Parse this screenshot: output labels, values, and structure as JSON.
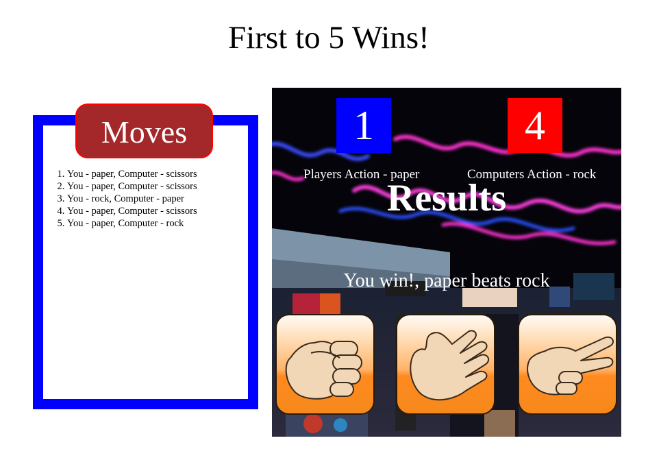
{
  "title": "First to 5 Wins!",
  "moves": {
    "heading": "Moves",
    "items": [
      "You - paper, Computer - scissors",
      "You - paper, Computer - scissors",
      "You - rock, Computer - paper",
      "You - paper, Computer - scissors",
      "You - paper, Computer - rock"
    ]
  },
  "scoreboard": {
    "player_score": "1",
    "computer_score": "4",
    "player_action": "Players Action - paper",
    "computer_action": "Computers Action - rock"
  },
  "results": {
    "title": "Results",
    "message": "You win!, paper beats rock"
  },
  "choices": [
    {
      "name": "rock",
      "icon": "rock-hand-icon"
    },
    {
      "name": "paper",
      "icon": "paper-hand-icon"
    },
    {
      "name": "scissors",
      "icon": "scissors-hand-icon"
    }
  ],
  "colors": {
    "player": "#0000ff",
    "computer": "#ff0000",
    "moves_border": "#0000ff",
    "moves_heading": "#a4282a"
  }
}
